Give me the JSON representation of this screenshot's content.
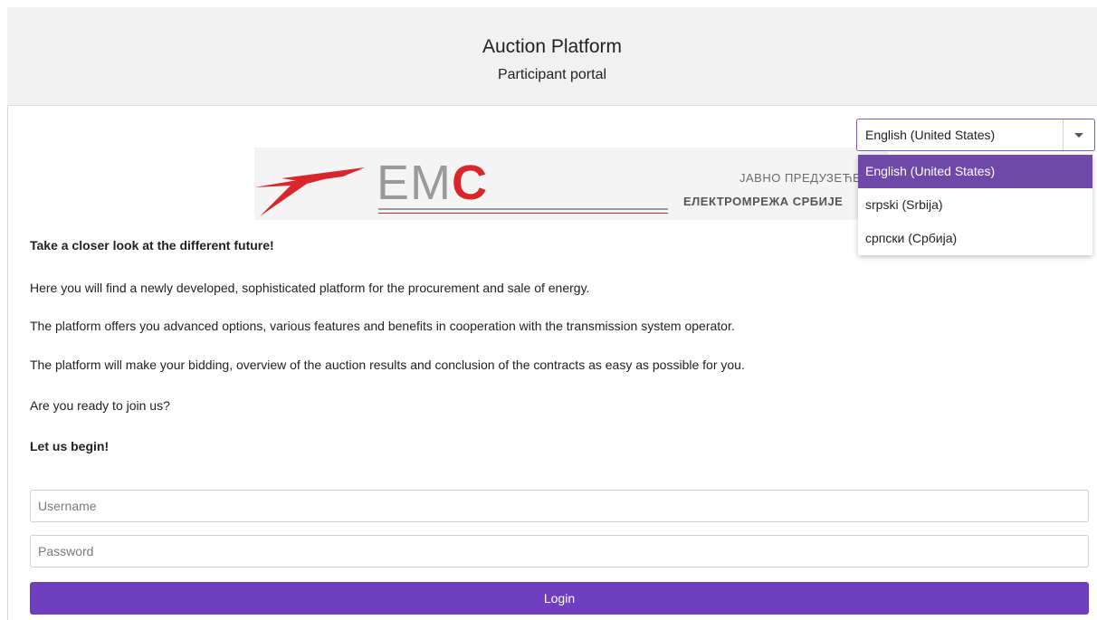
{
  "header": {
    "title": "Auction Platform",
    "subtitle": "Participant portal"
  },
  "logo": {
    "brand_prefix": "EM",
    "brand_accent": "C",
    "line1": "ЈАВНО ПРЕДУЗЕЋЕ",
    "line2": "ЕЛЕКТРОМРЕЖА СРБИЈЕ",
    "accent_color": "#d8262a"
  },
  "language": {
    "selected": "English (United States)",
    "options": [
      "English (United States)",
      "srpski (Srbija)",
      "српски (Србија)"
    ]
  },
  "intro": {
    "heading": "Take a closer look at the different future!",
    "p1": "Here you will find a newly developed, sophisticated platform for the procurement and sale of energy.",
    "p2": "The platform offers you advanced options, various features and benefits in cooperation with the transmission system operator.",
    "p3": "The platform will make your bidding, overview of the auction results and conclusion of the contracts as easy as possible for you.",
    "p4": "Are you ready to join us?",
    "cta": "Let us begin!"
  },
  "login": {
    "username_placeholder": "Username",
    "username_value": "",
    "password_placeholder": "Password",
    "password_value": "",
    "button_label": "Login",
    "button_color": "#6f3fbf"
  }
}
